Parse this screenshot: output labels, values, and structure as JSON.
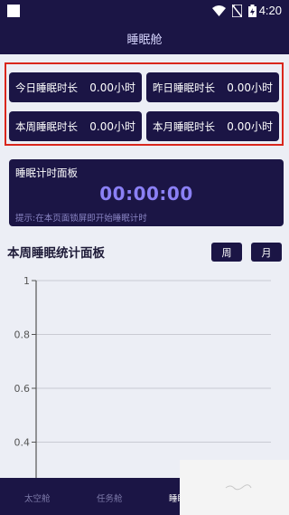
{
  "status_bar": {
    "time": "4:20"
  },
  "header": {
    "title": "睡眠舱"
  },
  "stats": {
    "today": {
      "label": "今日睡眠时长",
      "value": "0.00小时"
    },
    "yesterday": {
      "label": "昨日睡眠时长",
      "value": "0.00小时"
    },
    "this_week": {
      "label": "本周睡眠时长",
      "value": "0.00小时"
    },
    "this_month": {
      "label": "本月睡眠时长",
      "value": "0.00小时"
    }
  },
  "sleep_panel": {
    "title": "睡眠计时面板",
    "timer": "00:00:00",
    "hint": "提示:在本页面锁屏即开始睡眠计时"
  },
  "weekly_panel": {
    "title": "本周睡眠统计面板",
    "btn_week": "周",
    "btn_month": "月"
  },
  "chart_data": {
    "type": "bar",
    "categories": [],
    "values": [],
    "ylim": [
      0.4,
      1
    ],
    "yticks": [
      "1",
      "0.8",
      "0.6",
      "0.4"
    ],
    "grid": true
  },
  "bottom_nav": {
    "items": [
      {
        "label": "太空舱",
        "active": false
      },
      {
        "label": "任务舱",
        "active": false
      },
      {
        "label": "睡眠",
        "active": true
      }
    ]
  },
  "colors": {
    "primary": "#1b1545",
    "accent": "#8b80f5",
    "highlight_border": "#d9261c"
  }
}
